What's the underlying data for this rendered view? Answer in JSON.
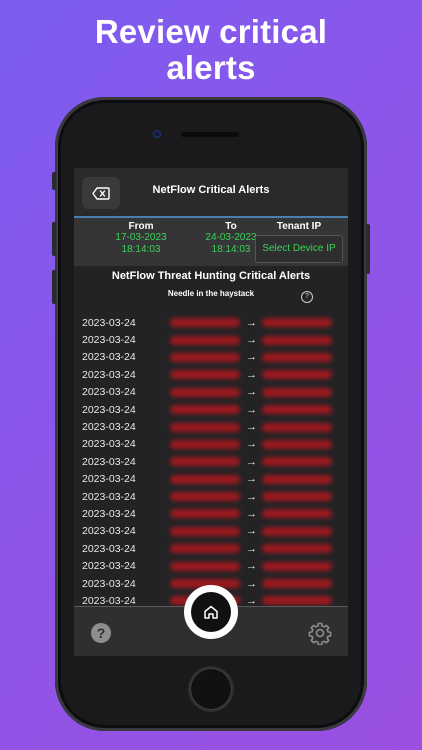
{
  "headline": {
    "line1": "Review critical",
    "line2": "alerts"
  },
  "appbar": {
    "title": "NetFlow Critical Alerts",
    "back_icon": "backspace-icon"
  },
  "filters": {
    "from": {
      "label": "From",
      "date": "17-03-2023",
      "time": "18:14:03"
    },
    "to": {
      "label": "To",
      "date": "24-03-2023",
      "time": "18:14:03"
    },
    "tenant": {
      "label": "Tenant IP",
      "button": "Select Device IP"
    },
    "accent_color": "#39d353"
  },
  "section": {
    "title": "NetFlow Threat Hunting Critical Alerts",
    "subtitle": "Needle in the haystack",
    "help_icon": "question-circle-icon"
  },
  "alerts": [
    {
      "date": "2023-03-24",
      "arrow": "→"
    },
    {
      "date": "2023-03-24",
      "arrow": "→"
    },
    {
      "date": "2023-03-24",
      "arrow": "→"
    },
    {
      "date": "2023-03-24",
      "arrow": "→"
    },
    {
      "date": "2023-03-24",
      "arrow": "→"
    },
    {
      "date": "2023-03-24",
      "arrow": "→"
    },
    {
      "date": "2023-03-24",
      "arrow": "→"
    },
    {
      "date": "2023-03-24",
      "arrow": "→"
    },
    {
      "date": "2023-03-24",
      "arrow": "→"
    },
    {
      "date": "2023-03-24",
      "arrow": "→"
    },
    {
      "date": "2023-03-24",
      "arrow": "→"
    },
    {
      "date": "2023-03-24",
      "arrow": "→"
    },
    {
      "date": "2023-03-24",
      "arrow": "→"
    },
    {
      "date": "2023-03-24",
      "arrow": "→"
    },
    {
      "date": "2023-03-24",
      "arrow": "→"
    },
    {
      "date": "2023-03-24",
      "arrow": "→"
    },
    {
      "date": "2023-03-24",
      "arrow": "→"
    }
  ],
  "tabbar": {
    "help_glyph": "?",
    "help_icon": "question-icon",
    "home_icon": "home-icon",
    "settings_icon": "gear-icon"
  }
}
